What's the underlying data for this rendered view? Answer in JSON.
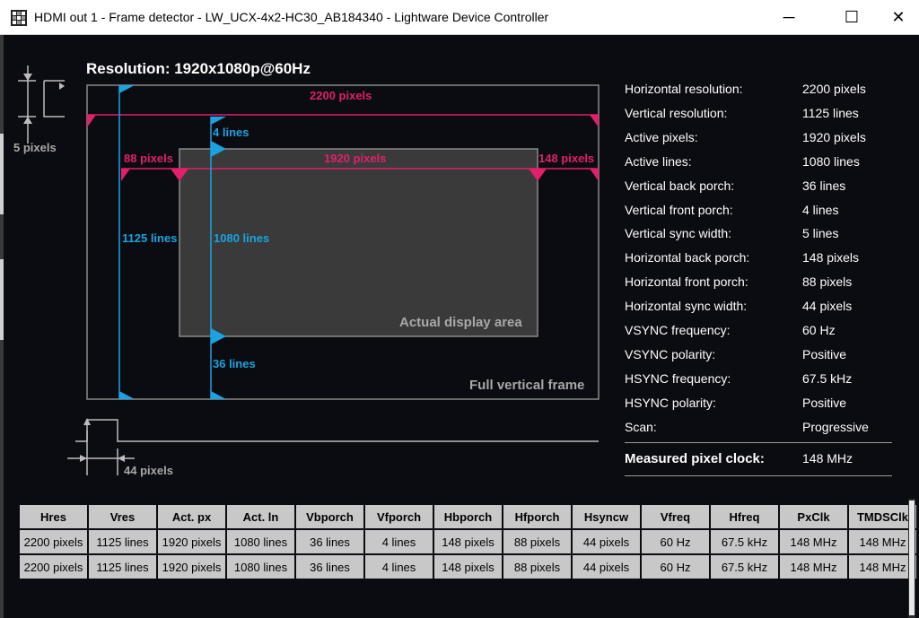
{
  "window": {
    "title": "HDMI out 1 - Frame detector - LW_UCX-4x2-HC30_AB184340 - Lightware Device Controller",
    "minimize": "─",
    "maximize": "☐",
    "close": "✕"
  },
  "diagram": {
    "resolution_title": "Resolution: 1920x1080p@60Hz",
    "total_width": "2200 pixels",
    "vsync_lines": "4 lines",
    "hsync_left": "5 pixels",
    "front_porch": "88 pixels",
    "active_width": "1920 pixels",
    "back_porch": "148 pixels",
    "total_lines": "1125 lines",
    "active_lines": "1080 lines",
    "vback_lines": "36 lines",
    "active_area": "Actual display area",
    "full_frame": "Full vertical frame",
    "hsync_width": "44 pixels"
  },
  "info": [
    {
      "key": "Horizontal resolution:",
      "value": "2200 pixels"
    },
    {
      "key": "Vertical resolution:",
      "value": "1125 lines"
    },
    {
      "key": "Active pixels:",
      "value": "1920 pixels"
    },
    {
      "key": "Active lines:",
      "value": "1080 lines"
    },
    {
      "key": "Vertical back porch:",
      "value": "36 lines"
    },
    {
      "key": "Vertical front porch:",
      "value": "4 lines"
    },
    {
      "key": "Vertical sync width:",
      "value": "5 lines"
    },
    {
      "key": "Horizontal back porch:",
      "value": "148 pixels"
    },
    {
      "key": "Horizontal front porch:",
      "value": "88 pixels"
    },
    {
      "key": "Horizontal sync width:",
      "value": "44 pixels"
    },
    {
      "key": "VSYNC frequency:",
      "value": "60 Hz"
    },
    {
      "key": "VSYNC polarity:",
      "value": "Positive"
    },
    {
      "key": "HSYNC frequency:",
      "value": "67.5 kHz"
    },
    {
      "key": "HSYNC polarity:",
      "value": "Positive"
    },
    {
      "key": "Scan:",
      "value": "Progressive"
    }
  ],
  "clock": {
    "key": "Measured pixel clock:",
    "value": "148 MHz"
  },
  "table": {
    "headers": [
      "Hres",
      "Vres",
      "Act. px",
      "Act. ln",
      "Vbporch",
      "Vfporch",
      "Hbporch",
      "Hfporch",
      "Hsyncw",
      "Vfreq",
      "Hfreq",
      "PxClk",
      "TMDSClk"
    ],
    "rows": [
      [
        "2200 pixels",
        "1125 lines",
        "1920 pixels",
        "1080 lines",
        "36 lines",
        "4 lines",
        "148 pixels",
        "88 pixels",
        "44 pixels",
        "60 Hz",
        "67.5 kHz",
        "148 MHz",
        "148 MHz"
      ],
      [
        "2200 pixels",
        "1125 lines",
        "1920 pixels",
        "1080 lines",
        "36 lines",
        "4 lines",
        "148 pixels",
        "88 pixels",
        "44 pixels",
        "60 Hz",
        "67.5 kHz",
        "148 MHz",
        "148 MHz"
      ]
    ]
  },
  "colors": {
    "pink": "#e0206a",
    "blue": "#1aa3e0",
    "background": "#0b0b12",
    "frame": "#8a8a8a"
  }
}
